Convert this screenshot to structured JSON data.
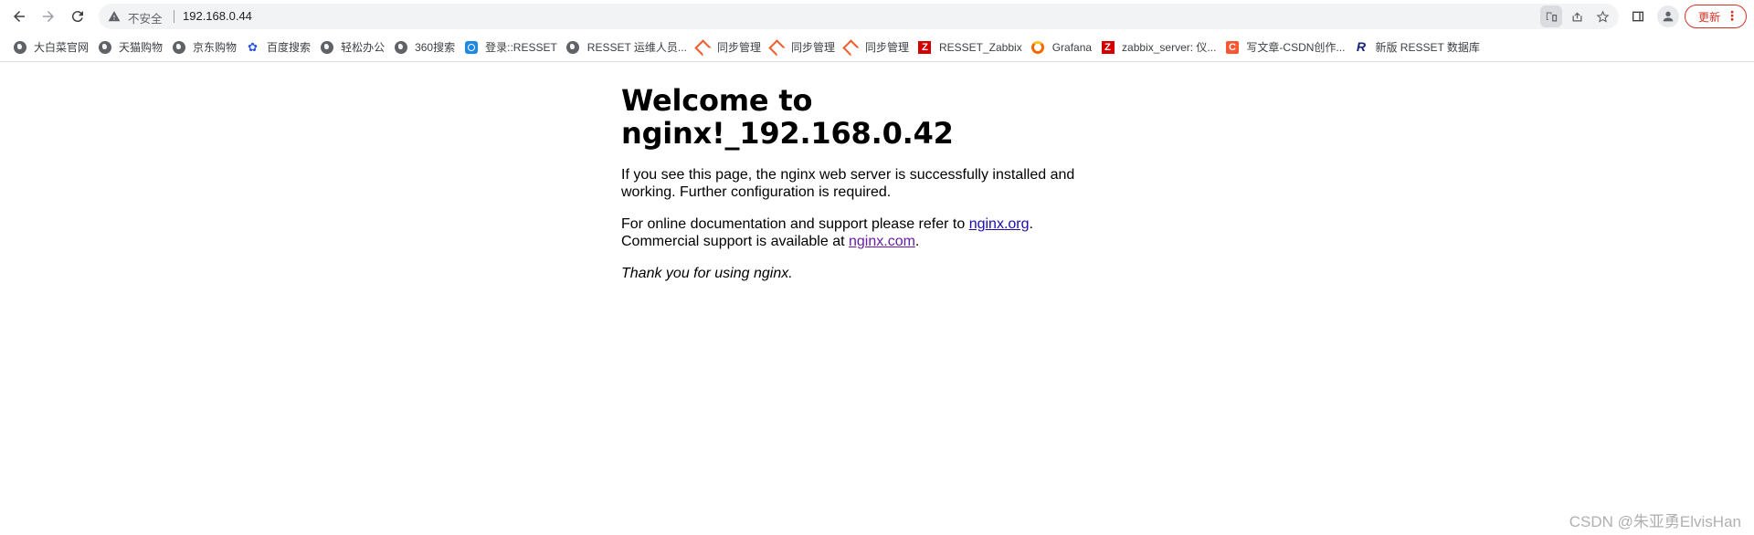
{
  "browser": {
    "security_label": "不安全",
    "url": "192.168.0.44",
    "update_label": "更新",
    "icons": {
      "back": "back-arrow-icon",
      "forward": "forward-arrow-icon",
      "reload": "reload-icon",
      "warning": "warning-icon",
      "translate": "translate-icon",
      "share": "share-icon",
      "bookmark": "star-icon",
      "side_panel": "side-panel-icon",
      "profile": "profile-icon",
      "menu": "more-vert-icon"
    }
  },
  "bookmarks": [
    {
      "label": "大白菜官网",
      "icon": "globe-icon"
    },
    {
      "label": "天猫购物",
      "icon": "globe-icon"
    },
    {
      "label": "京东购物",
      "icon": "globe-icon"
    },
    {
      "label": "百度搜索",
      "icon": "baidu-paw-icon"
    },
    {
      "label": "轻松办公",
      "icon": "globe-icon"
    },
    {
      "label": "360搜索",
      "icon": "globe-icon"
    },
    {
      "label": "登录::RESSET",
      "icon": "resset-spiral-icon"
    },
    {
      "label": "RESSET 运维人员...",
      "icon": "globe-icon"
    },
    {
      "label": "同步管理",
      "icon": "sync-icon"
    },
    {
      "label": "同步管理",
      "icon": "sync-icon"
    },
    {
      "label": "同步管理",
      "icon": "sync-icon"
    },
    {
      "label": "RESSET_Zabbix",
      "icon": "zabbix-icon"
    },
    {
      "label": "Grafana",
      "icon": "grafana-icon"
    },
    {
      "label": "zabbix_server: 仪...",
      "icon": "zabbix-icon"
    },
    {
      "label": "写文章-CSDN创作...",
      "icon": "csdn-icon"
    },
    {
      "label": "新版 RESSET 数据库",
      "icon": "resset-r-icon"
    }
  ],
  "page": {
    "heading": "Welcome to nginx!_192.168.0.42",
    "para1": "If you see this page, the nginx web server is successfully installed and working. Further configuration is required.",
    "para2_prefix": "For online documentation and support please refer to ",
    "link_org": "nginx.org",
    "para2_suffix": ".",
    "para3_prefix": "Commercial support is available at ",
    "link_com": "nginx.com",
    "para3_suffix": ".",
    "thanks": "Thank you for using nginx."
  },
  "watermark": "CSDN @朱亚勇ElvisHan",
  "colors": {
    "link": "#1a0dab",
    "visited_link": "#681da8",
    "update_red": "#d93025",
    "omnibox_bg": "#f1f3f4"
  }
}
